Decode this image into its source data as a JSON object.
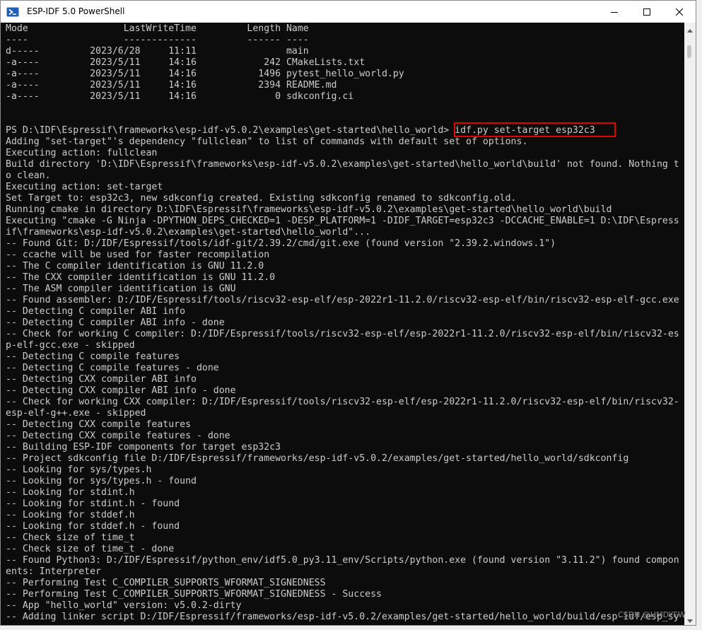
{
  "window": {
    "title": "ESP-IDF 5.0 PowerShell",
    "icon": "powershell-icon",
    "controls": [
      "minimize-icon",
      "maximize-icon",
      "close-icon"
    ]
  },
  "terminal": {
    "lines": [
      "Mode                 LastWriteTime         Length Name",
      "----                 -------------         ------ ----",
      "d-----         2023/6/28     11:11                main",
      "-a----         2023/5/11     14:16            242 CMakeLists.txt",
      "-a----         2023/5/11     14:16           1496 pytest_hello_world.py",
      "-a----         2023/5/11     14:16           2394 README.md",
      "-a----         2023/5/11     14:16              0 sdkconfig.ci",
      "",
      "",
      "PS D:\\IDF\\Espressif\\frameworks\\esp-idf-v5.0.2\\examples\\get-started\\hello_world> idf.py set-target esp32c3",
      "Adding \"set-target\"'s dependency \"fullclean\" to list of commands with default set of options.",
      "Executing action: fullclean",
      "Build directory 'D:\\IDF\\Espressif\\frameworks\\esp-idf-v5.0.2\\examples\\get-started\\hello_world\\build' not found. Nothing t",
      "o clean.",
      "Executing action: set-target",
      "Set Target to: esp32c3, new sdkconfig created. Existing sdkconfig renamed to sdkconfig.old.",
      "Running cmake in directory D:\\IDF\\Espressif\\frameworks\\esp-idf-v5.0.2\\examples\\get-started\\hello_world\\build",
      "Executing \"cmake -G Ninja -DPYTHON_DEPS_CHECKED=1 -DESP_PLATFORM=1 -DIDF_TARGET=esp32c3 -DCCACHE_ENABLE=1 D:\\IDF\\Espress",
      "if\\frameworks\\esp-idf-v5.0.2\\examples\\get-started\\hello_world\"...",
      "-- Found Git: D:/IDF/Espressif/tools/idf-git/2.39.2/cmd/git.exe (found version \"2.39.2.windows.1\")",
      "-- ccache will be used for faster recompilation",
      "-- The C compiler identification is GNU 11.2.0",
      "-- The CXX compiler identification is GNU 11.2.0",
      "-- The ASM compiler identification is GNU",
      "-- Found assembler: D:/IDF/Espressif/tools/riscv32-esp-elf/esp-2022r1-11.2.0/riscv32-esp-elf/bin/riscv32-esp-elf-gcc.exe",
      "-- Detecting C compiler ABI info",
      "-- Detecting C compiler ABI info - done",
      "-- Check for working C compiler: D:/IDF/Espressif/tools/riscv32-esp-elf/esp-2022r1-11.2.0/riscv32-esp-elf/bin/riscv32-es",
      "p-elf-gcc.exe - skipped",
      "-- Detecting C compile features",
      "-- Detecting C compile features - done",
      "-- Detecting CXX compiler ABI info",
      "-- Detecting CXX compiler ABI info - done",
      "-- Check for working CXX compiler: D:/IDF/Espressif/tools/riscv32-esp-elf/esp-2022r1-11.2.0/riscv32-esp-elf/bin/riscv32-",
      "esp-elf-g++.exe - skipped",
      "-- Detecting CXX compile features",
      "-- Detecting CXX compile features - done",
      "-- Building ESP-IDF components for target esp32c3",
      "-- Project sdkconfig file D:/IDF/Espressif/frameworks/esp-idf-v5.0.2/examples/get-started/hello_world/sdkconfig",
      "-- Looking for sys/types.h",
      "-- Looking for sys/types.h - found",
      "-- Looking for stdint.h",
      "-- Looking for stdint.h - found",
      "-- Looking for stddef.h",
      "-- Looking for stddef.h - found",
      "-- Check size of time_t",
      "-- Check size of time_t - done",
      "-- Found Python3: D:/IDF/Espressif/python_env/idf5.0_py3.11_env/Scripts/python.exe (found version \"3.11.2\") found compon",
      "ents: Interpreter",
      "-- Performing Test C_COMPILER_SUPPORTS_WFORMAT_SIGNEDNESS",
      "-- Performing Test C_COMPILER_SUPPORTS_WFORMAT_SIGNEDNESS - Success",
      "-- App \"hello_world\" version: v5.0.2-dirty",
      "-- Adding linker script D:/IDF/Espressif/frameworks/esp-idf-v5.0.2/examples/get-started/hello_world/build/esp-idf/esp_sy"
    ],
    "highlighted_command": "idf.py set-target esp32c3"
  },
  "colors": {
    "console_bg": "#0c0c0c",
    "console_text": "#cccccc",
    "highlight_border": "#e00000"
  },
  "watermark": "CSDN @HMDYEW"
}
